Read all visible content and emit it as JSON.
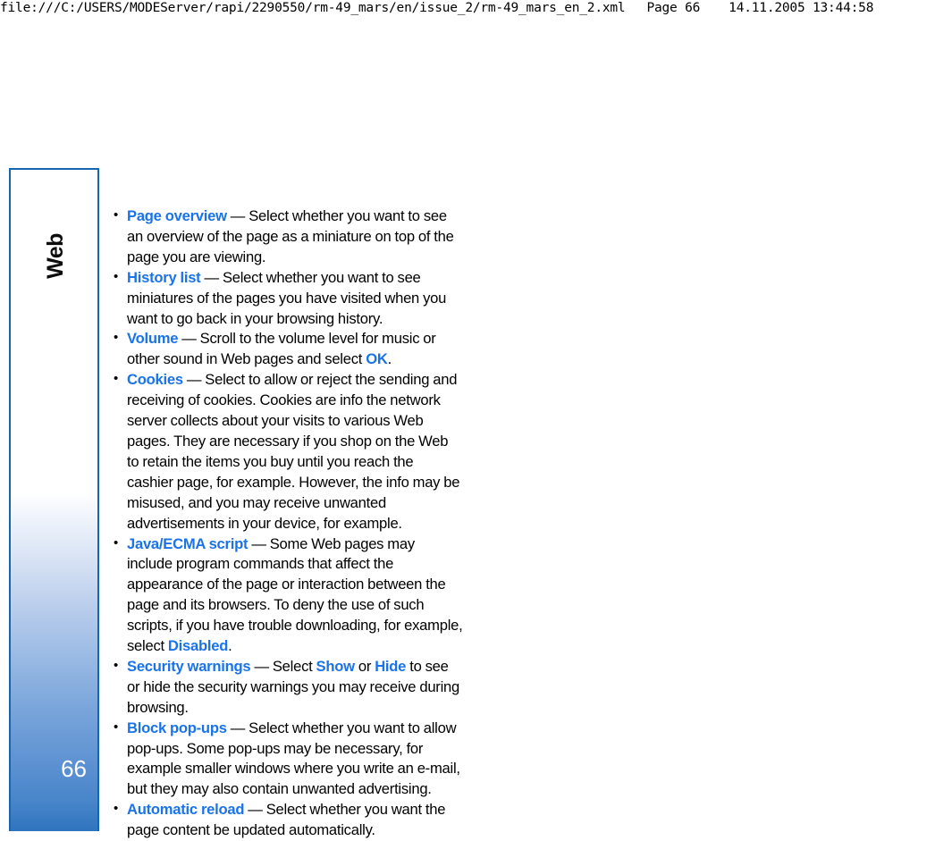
{
  "print_header": {
    "url": "file:///C:/USERS/MODEServer/rapi/2290550/rm-49_mars/en/issue_2/rm-49_mars_en_2.xml",
    "page_label": "Page 66",
    "datetime": "14.11.2005 13:44:58"
  },
  "side_tab": {
    "chapter_label": "Web",
    "page_number": "66",
    "border_color": "#1565b0",
    "gradient_bottom_color": "#2f74be",
    "page_number_color": "#ffffff"
  },
  "theme": {
    "keyword_color": "#1a73e8",
    "body_text_color": "#000000",
    "background": "#ffffff"
  },
  "content": {
    "bullets": [
      {
        "term": "Page overview",
        "separator": " — ",
        "body_before": "Select whether you want to see an overview of the page as a miniature on top of the page you are viewing.",
        "inline_keywords": [],
        "body_after": ""
      },
      {
        "term": "History list",
        "separator": " — ",
        "body_before": "Select whether you want to see miniatures of the pages you have visited when you want to go back in your browsing history.",
        "inline_keywords": [],
        "body_after": ""
      },
      {
        "term": "Volume",
        "separator": " — ",
        "body_before": "Scroll to the volume level for music or other sound in Web pages and select ",
        "inline_keywords": [
          "OK"
        ],
        "body_after": "."
      },
      {
        "term": "Cookies",
        "separator": " — ",
        "body_before": "Select to allow or reject the sending and receiving of cookies. Cookies are info the network server collects about your visits to various Web pages. They are necessary if you shop on the Web to retain the items you buy until you reach the cashier page, for example. However, the info may be misused, and you may receive unwanted advertisements in your device, for example.",
        "inline_keywords": [],
        "body_after": ""
      },
      {
        "term": "Java/ECMA script",
        "separator": " — ",
        "body_before": "Some Web pages may include program commands that affect the appearance of the page or interaction between the page and its browsers. To deny the use of such scripts, if you have trouble downloading, for example, select ",
        "inline_keywords": [
          "Disabled"
        ],
        "body_after": "."
      },
      {
        "term": "Security warnings",
        "separator": " — ",
        "body_before": "Select ",
        "inline_keywords": [
          "Show",
          "Hide"
        ],
        "body_mid": " or ",
        "body_after": " to see or hide the security warnings you may receive during browsing."
      },
      {
        "term": "Block pop-ups",
        "separator": " — ",
        "body_before": "Select whether you want to allow pop-ups. Some pop-ups may be necessary, for example smaller windows where you write an e-mail, but they may also contain unwanted advertising.",
        "inline_keywords": [],
        "body_after": ""
      },
      {
        "term": "Automatic reload",
        "separator": " — ",
        "body_before": "Select whether you want the page content be updated automatically.",
        "inline_keywords": [],
        "body_after": ""
      }
    ]
  }
}
